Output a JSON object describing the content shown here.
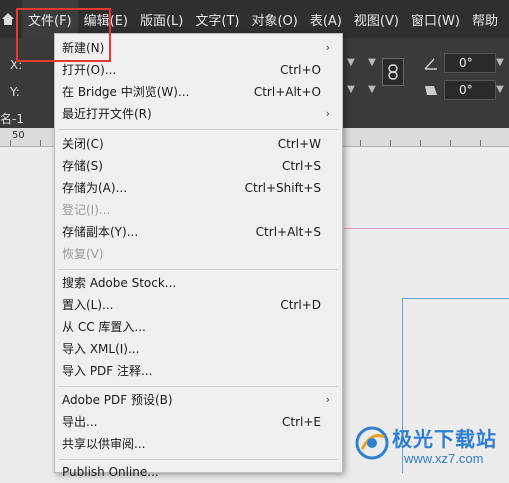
{
  "menubar": {
    "items": [
      "文件(F)",
      "编辑(E)",
      "版面(L)",
      "文字(T)",
      "对象(O)",
      "表(A)",
      "视图(V)",
      "窗口(W)",
      "帮助"
    ]
  },
  "control_bar": {
    "x_label": "X:",
    "y_label": "Y:",
    "angle1": "0°",
    "angle2": "0°"
  },
  "tab_label": "名-1",
  "ruler_label": "50",
  "file_menu": {
    "items": [
      {
        "label": "新建(N)",
        "shortcut": "",
        "submenu": true,
        "disabled": false
      },
      {
        "label": "打开(O)...",
        "shortcut": "Ctrl+O",
        "submenu": false,
        "disabled": false
      },
      {
        "label": "在 Bridge 中浏览(W)...",
        "shortcut": "Ctrl+Alt+O",
        "submenu": false,
        "disabled": false
      },
      {
        "label": "最近打开文件(R)",
        "shortcut": "",
        "submenu": true,
        "disabled": false
      },
      {
        "label": "关闭(C)",
        "shortcut": "Ctrl+W",
        "submenu": false,
        "disabled": false
      },
      {
        "label": "存储(S)",
        "shortcut": "Ctrl+S",
        "submenu": false,
        "disabled": false
      },
      {
        "label": "存储为(A)...",
        "shortcut": "Ctrl+Shift+S",
        "submenu": false,
        "disabled": false
      },
      {
        "label": "登记(I)...",
        "shortcut": "",
        "submenu": false,
        "disabled": true
      },
      {
        "label": "存储副本(Y)...",
        "shortcut": "Ctrl+Alt+S",
        "submenu": false,
        "disabled": false
      },
      {
        "label": "恢复(V)",
        "shortcut": "",
        "submenu": false,
        "disabled": true
      },
      {
        "label": "搜索 Adobe Stock...",
        "shortcut": "",
        "submenu": false,
        "disabled": false
      },
      {
        "label": "置入(L)...",
        "shortcut": "Ctrl+D",
        "submenu": false,
        "disabled": false
      },
      {
        "label": "从 CC 库置入...",
        "shortcut": "",
        "submenu": false,
        "disabled": false
      },
      {
        "label": "导入 XML(I)...",
        "shortcut": "",
        "submenu": false,
        "disabled": false
      },
      {
        "label": "导入 PDF 注释...",
        "shortcut": "",
        "submenu": false,
        "disabled": false
      },
      {
        "label": "Adobe PDF 预设(B)",
        "shortcut": "",
        "submenu": true,
        "disabled": false
      },
      {
        "label": "导出...",
        "shortcut": "Ctrl+E",
        "submenu": false,
        "disabled": false
      },
      {
        "label": "共享以供审阅...",
        "shortcut": "",
        "submenu": false,
        "disabled": false
      },
      {
        "label": "Publish Online...",
        "shortcut": "",
        "submenu": false,
        "disabled": false
      }
    ]
  },
  "watermark": {
    "title": "极光下载站",
    "url": "www.xz7.com"
  },
  "colors": {
    "menubar_bg": "#2f2f2f",
    "menu_bg": "#f0f0f0",
    "highlight_box": "#e53a2f",
    "watermark_blue": "#2f7fd1"
  }
}
